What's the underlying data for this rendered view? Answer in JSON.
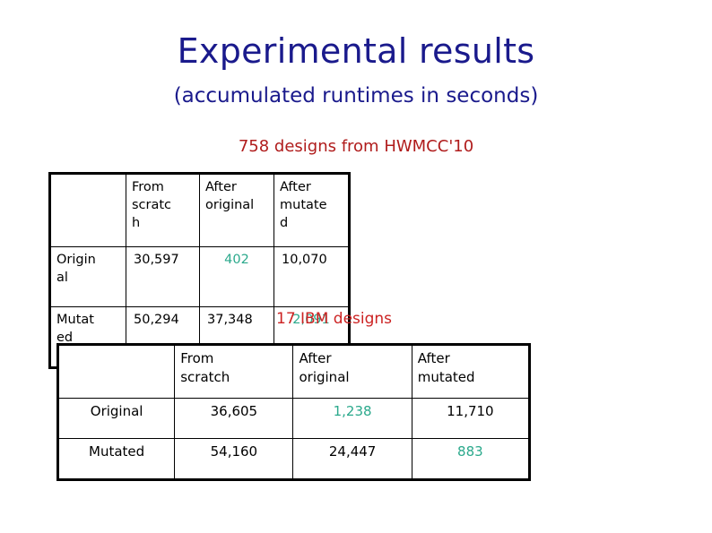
{
  "slide": {
    "title": "Experimental results",
    "subtitle": "(accumulated runtimes in seconds)",
    "accent_navy": "#1A1A8C",
    "accent_red": "#B01C1C",
    "accent_teal": "#2BA98C"
  },
  "table_one": {
    "caption": "758 designs from HWMCC'10",
    "corner_label": "",
    "columns": [
      "From scratc h",
      "After original",
      "After mutate d"
    ],
    "column_lines": [
      [
        "From",
        "scratc",
        "h"
      ],
      [
        "After",
        "original",
        ""
      ],
      [
        "After",
        "mutate",
        "d"
      ]
    ],
    "rows": [
      {
        "label_lines": [
          "Origin",
          "al"
        ],
        "label": "Original",
        "from_scratch": "30,597",
        "after_original": "402",
        "after_mutated": "10,070",
        "highlight": "after_original"
      },
      {
        "label_lines": [
          "Mutat",
          "ed"
        ],
        "label": "Mutated",
        "from_scratch": "50,294",
        "after_original": "37,348",
        "after_mutated": "2,091",
        "highlight": "after_mutated"
      }
    ]
  },
  "table_two": {
    "caption": "17 IBM designs",
    "corner_label": "",
    "columns": [
      "From scratch",
      "After original",
      "After mutated"
    ],
    "column_lines": [
      [
        "From",
        "scratch"
      ],
      [
        "After",
        "original"
      ],
      [
        "After",
        "mutated"
      ]
    ],
    "rows": [
      {
        "label": "Original",
        "from_scratch": "36,605",
        "after_original": "1,238",
        "after_mutated": "11,710",
        "highlight": "after_original"
      },
      {
        "label": "Mutated",
        "from_scratch": "54,160",
        "after_original": "24,447",
        "after_mutated": "883",
        "highlight": "after_mutated"
      }
    ]
  },
  "chart_data": {
    "type": "table",
    "title": "Experimental results (accumulated runtimes in seconds)",
    "tables": [
      {
        "name": "758 designs from HWMCC'10",
        "row_header": "",
        "categories": [
          "From scratch",
          "After original",
          "After mutated"
        ],
        "rows": [
          "Original",
          "Mutated"
        ],
        "values": [
          [
            30597,
            402,
            10070
          ],
          [
            50294,
            37348,
            2091
          ]
        ],
        "highlighted_cells": [
          [
            0,
            1
          ],
          [
            1,
            2
          ]
        ],
        "units": "seconds"
      },
      {
        "name": "17 IBM designs",
        "row_header": "",
        "categories": [
          "From scratch",
          "After original",
          "After mutated"
        ],
        "rows": [
          "Original",
          "Mutated"
        ],
        "values": [
          [
            36605,
            1238,
            11710
          ],
          [
            54160,
            24447,
            883
          ]
        ],
        "highlighted_cells": [
          [
            0,
            1
          ],
          [
            1,
            2
          ]
        ],
        "units": "seconds"
      }
    ]
  }
}
